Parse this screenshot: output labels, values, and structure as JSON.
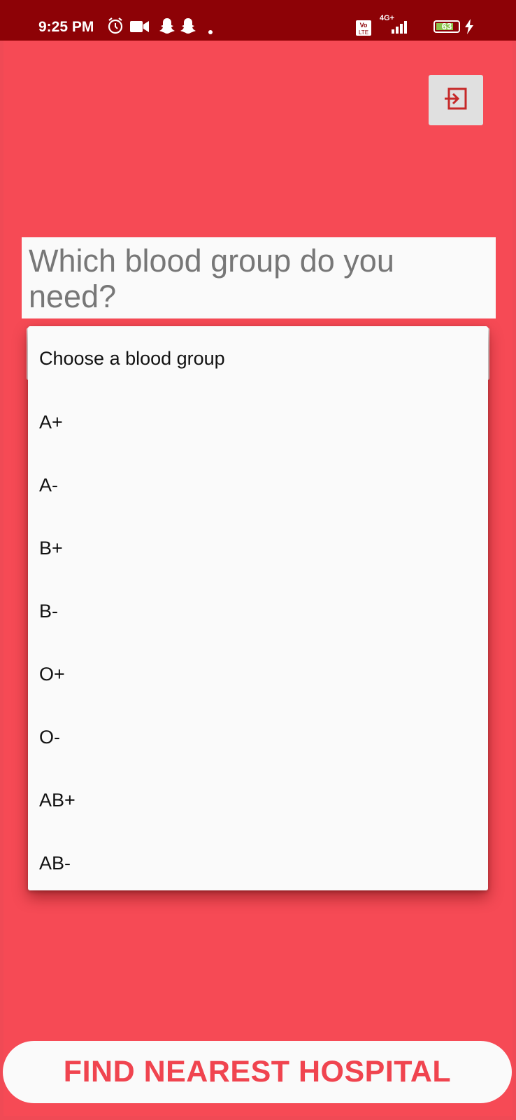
{
  "status_bar": {
    "time": "9:25 PM",
    "network": "4G+",
    "volte": "Vo LTE",
    "battery": "63",
    "icons": [
      "alarm-icon",
      "video-icon",
      "snapchat-icon",
      "snapchat-icon",
      "dot-icon",
      "volte-icon",
      "signal-icon",
      "battery-icon",
      "charging-icon"
    ]
  },
  "header": {
    "exit_icon": "exit-to-app-icon",
    "exit_icon_color": "#c62828"
  },
  "question": {
    "text": "Which blood group do you need?"
  },
  "dropdown": {
    "placeholder": "Choose a blood group",
    "options": [
      "A+",
      "A-",
      "B+",
      "B-",
      "O+",
      "O-",
      "AB+",
      "AB-"
    ]
  },
  "find_button": {
    "label": "FIND NEAREST HOSPITAL",
    "text_color": "#f0444f"
  },
  "colors": {
    "status_bar": "#8d0206",
    "background": "#f64a55",
    "card": "#fafafa"
  }
}
